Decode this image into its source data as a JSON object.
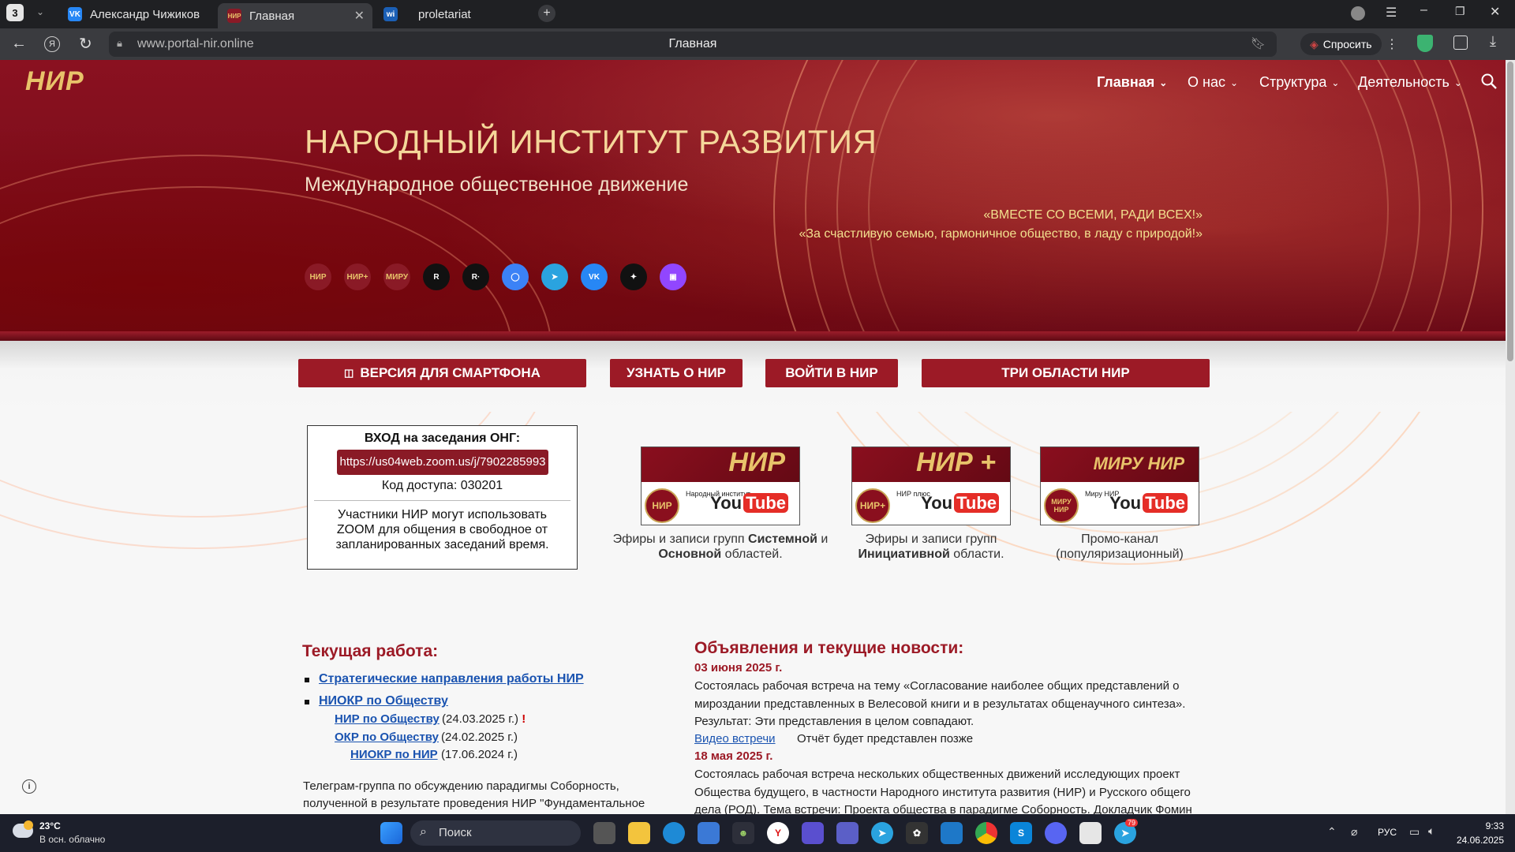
{
  "browser": {
    "tab_counter": "3",
    "tabs": [
      {
        "label": "Александр Чижиков",
        "favicon": "VK"
      },
      {
        "label": "Главная",
        "favicon": "НИР"
      },
      {
        "label": "proletariat",
        "favicon": "wi"
      }
    ],
    "url": "www.portal-nir.online",
    "page_title": "Главная",
    "ask_label": "Спросить"
  },
  "site": {
    "logo": "НИР",
    "nav": [
      {
        "label": "Главная"
      },
      {
        "label": "О нас"
      },
      {
        "label": "Структура"
      },
      {
        "label": "Деятельность"
      }
    ],
    "hero_title": "НАРОДНЫЙ ИНСТИТУТ РАЗВИТИЯ",
    "hero_subtitle": "Международное общественное движение",
    "slogan_1": "«ВМЕСТЕ СО ВСЕМИ, РАДИ ВСЕХ!»",
    "slogan_2": "«За счастливую семью, гармоничное общество, в ладу с природой!»",
    "social_icons": [
      {
        "name": "nir-icon",
        "text": "НИР",
        "color": "#8a1a26"
      },
      {
        "name": "nir-plus-icon",
        "text": "НИР+",
        "color": "#8a1a26"
      },
      {
        "name": "miru-nir-icon",
        "text": "МИРУ",
        "color": "#8a1a26"
      },
      {
        "name": "rutube-icon",
        "text": "R",
        "color": "#111"
      },
      {
        "name": "rutube-plus-icon",
        "text": "R·",
        "color": "#111"
      },
      {
        "name": "odnoklassniki-circle-icon",
        "text": "◯",
        "color": "#3b82f6"
      },
      {
        "name": "telegram-icon",
        "text": "➤",
        "color": "#2aa3df"
      },
      {
        "name": "vk-icon",
        "text": "VK",
        "color": "#2787f5"
      },
      {
        "name": "dzen-icon",
        "text": "✦",
        "color": "#111"
      },
      {
        "name": "twitch-icon",
        "text": "▣",
        "color": "#9146ff"
      }
    ],
    "buttons": {
      "smartphone": "ВЕРСИЯ ДЛЯ СМАРТФОНА",
      "learn": "УЗНАТЬ О НИР",
      "login": "ВОЙТИ В НИР",
      "areas": "ТРИ ОБЛАСТИ НИР"
    },
    "zoom": {
      "title": "ВХОД на заседания ОНГ:",
      "link": "https://us04web.zoom.us/j/7902285993",
      "code_label": "Код доступа:",
      "code": "030201",
      "note": "Участники НИР могут использовать ZOOM для общения в свободное от запланированных заседаний время."
    },
    "youtube_cards": [
      {
        "big": "НИР",
        "round": "НИР",
        "channel": "Народный институт ...",
        "caption_pre": "Эфиры и записи групп ",
        "caption_b1": "Системной",
        "caption_mid": " и ",
        "caption_b2": "Основной",
        "caption_post": " областей."
      },
      {
        "big": "НИР +",
        "round": "НИР+",
        "channel": "НИР плюс",
        "caption_pre": "Эфиры и записи групп ",
        "caption_b1": "Инициативной",
        "caption_post": " области."
      },
      {
        "big": "МИРУ НИР",
        "round": "МИРУ НИР",
        "channel": "Миру НИР",
        "caption_line1": "Промо-канал",
        "caption_line2": "(популяризационный)"
      }
    ],
    "youtube_label": "You",
    "youtube_label_2": "Tube",
    "current_work": {
      "title": "Текущая работа:",
      "items": [
        {
          "label": "Стратегические направления работы НИР"
        },
        {
          "label": "НИОКР по Обществу"
        }
      ],
      "sub": [
        {
          "label": "НИР по Обществу",
          "date": "(24.03.2025 г.)",
          "mark": "!"
        },
        {
          "label": "ОКР по Обществу",
          "date": "(24.02.2025 г.)"
        },
        {
          "label": "НИОКР по НИР",
          "date": "(17.06.2024 г.)"
        }
      ],
      "telegram_text_1": "Телеграм-группа по обсуждению парадигмы Соборность,",
      "telegram_text_2": "полученной в результате проведения НИР \"Фундаментальное"
    },
    "news": {
      "title": "Объявления и текущие новости:",
      "date_1": "03 июня 2025 г.",
      "text_1a": "Состоялась рабочая встреча на тему «Согласование наиболее общих представлений о",
      "text_1b": "мироздании представленных в Велесовой книги и в результатах общенаучного синтеза».",
      "text_1c": "Результат: Эти представления в целом совпадают.",
      "video_link": "Видео встречи",
      "report_note": "Отчёт будет представлен позже",
      "date_2": "18 мая 2025 г.",
      "text_2a": "Состоялась рабочая встреча нескольких общественных движений исследующих проект",
      "text_2b": "Общества будущего, в частности  Народного института развития (НИР) и Русского общего",
      "text_2c": "дела (РОД). Тема встречи: Проекта общества в парадигме Соборность. Докладчик Фомин"
    }
  },
  "taskbar": {
    "temperature": "23°C",
    "weather": "В осн. облачно",
    "search": "Поиск",
    "language": "РУС",
    "time": "9:33",
    "date": "24.06.2025",
    "telegram_badge": "79"
  }
}
